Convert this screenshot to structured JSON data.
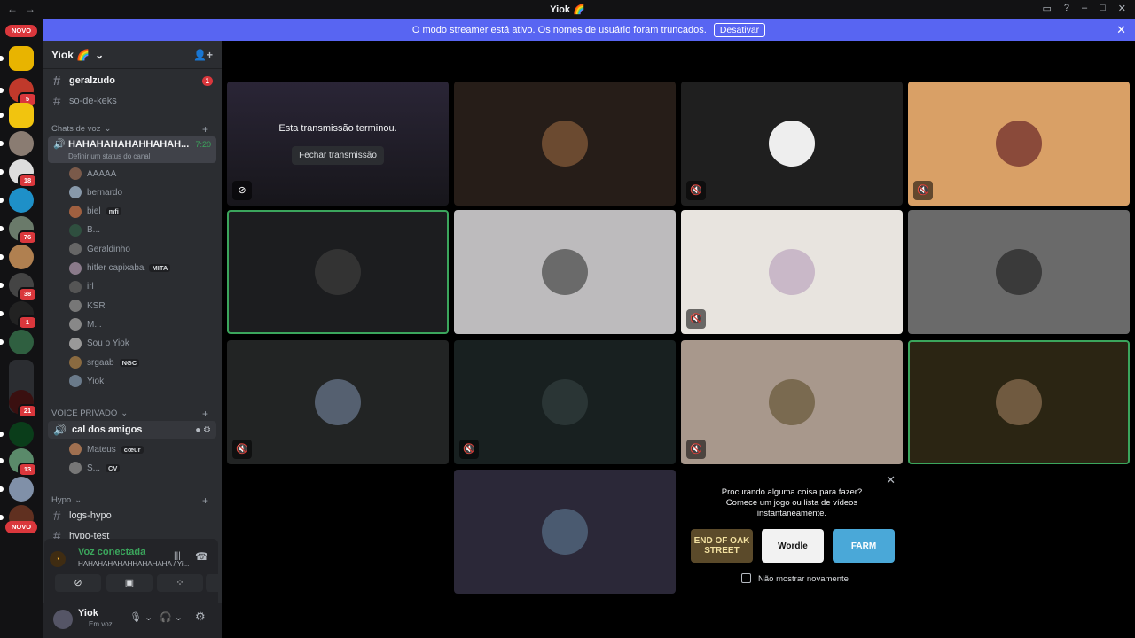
{
  "titlebar": {
    "title": "Yiok 🌈",
    "back": "←",
    "forward": "→"
  },
  "banner": {
    "text": "O modo streamer está ativo. Os nomes de usuário foram truncados.",
    "button": "Desativar"
  },
  "servers": {
    "novo_label": "NOVO",
    "badges": [
      "5",
      "18",
      "76",
      "38",
      "1",
      "21",
      "13"
    ]
  },
  "sidebar": {
    "server_name": "Yiok 🌈",
    "channels_top": [
      {
        "name": "geralzudo",
        "badge": "1"
      },
      {
        "name": "so-de-keks"
      }
    ],
    "voice_category": "Chats de voz",
    "active_voice": {
      "name": "HAHAHAHAHAHHAHAH...",
      "timer": "7:20",
      "status": "Definir um status do canal"
    },
    "voice_users": [
      {
        "name": "AAAAA"
      },
      {
        "name": "bernardo"
      },
      {
        "name": "biel",
        "tag": "mfi"
      },
      {
        "name": "B..."
      },
      {
        "name": "Geraldinho"
      },
      {
        "name": "hitler capixaba",
        "tag": "MITA"
      },
      {
        "name": "irl"
      },
      {
        "name": "KSR"
      },
      {
        "name": "M..."
      },
      {
        "name": "Sou o Yiok"
      },
      {
        "name": "srgaab",
        "tag": "NGC"
      },
      {
        "name": "Yiok"
      }
    ],
    "private_category": "VOICE PRIVADO",
    "private_channel": "cal dos amigos",
    "private_users": [
      {
        "name": "Mateus",
        "tag": "cœur"
      },
      {
        "name": "S...",
        "tag": "CV"
      }
    ],
    "hypo_category": "Hypo",
    "hypo_channels": [
      "logs-hypo",
      "hypo-test"
    ]
  },
  "voice_panel": {
    "status": "Voz conectada",
    "channel": "HAHAHAHAHAHHAHAHAHA / Yi..."
  },
  "user_panel": {
    "name": "Yiok",
    "status": "Em voz"
  },
  "stream": {
    "ended_text": "Esta transmissão terminou.",
    "close_button": "Fechar transmissão"
  },
  "activity": {
    "prompt": "Procurando alguma coisa para fazer? Comece um jogo ou lista de vídeos instantaneamente.",
    "games": [
      "END OF OAK STREET",
      "Wordle",
      "FARM"
    ],
    "checkbox": "Não mostrar novamente"
  },
  "colors": {
    "accent": "#5865f2",
    "speaking": "#3ba55c",
    "danger": "#da373c"
  }
}
